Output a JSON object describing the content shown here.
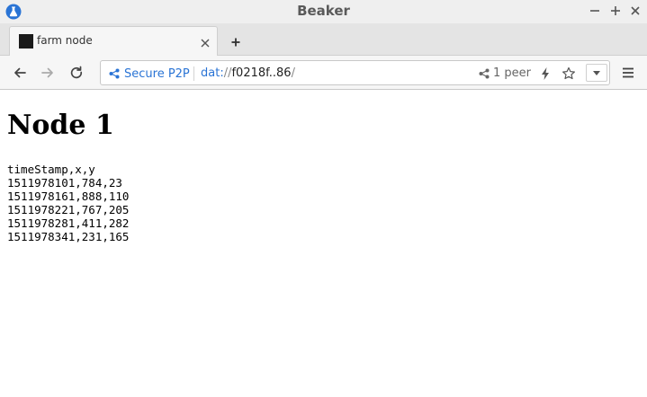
{
  "window": {
    "title": "Beaker",
    "app_icon": "beaker-flask-icon",
    "controls": [
      "minimize-icon",
      "maximize-icon",
      "close-icon"
    ]
  },
  "tabs": [
    {
      "title": "farm node",
      "favicon": "black-square-favicon",
      "active": true
    }
  ],
  "toolbar": {
    "secure_label": "Secure P2P",
    "url": {
      "scheme": "dat:",
      "slashes": "//",
      "host": "f0218f..86",
      "path": "/"
    },
    "peers": "1 peer"
  },
  "page": {
    "heading": "Node 1",
    "csv": {
      "header": "timeStamp,x,y",
      "rows": [
        "1511978101,784,23",
        "1511978161,888,110",
        "1511978221,767,205",
        "1511978281,411,282",
        "1511978341,231,165"
      ]
    }
  },
  "colors": {
    "accent": "#2a74d5",
    "titlebar": "#efefef",
    "tabbar": "#e4e4e4",
    "toolbar": "#f6f6f6"
  }
}
